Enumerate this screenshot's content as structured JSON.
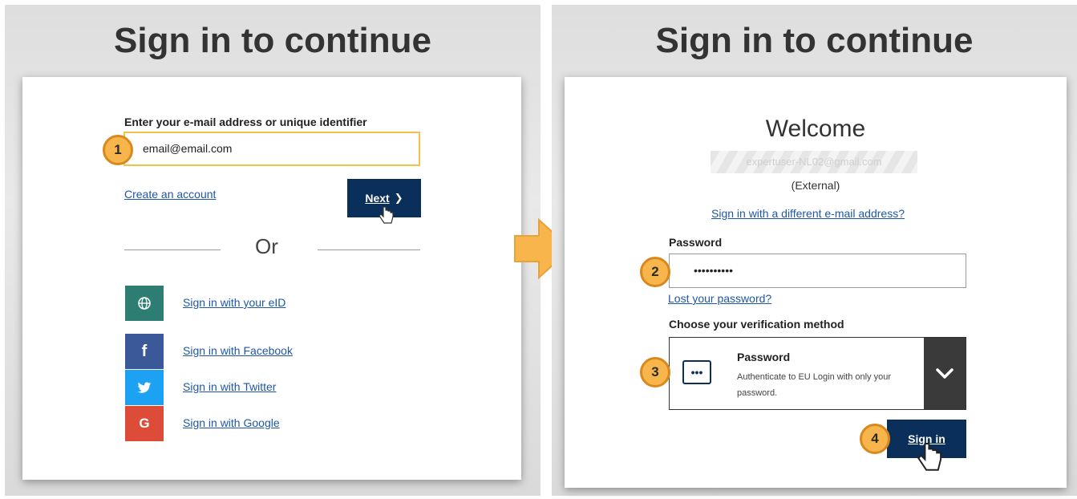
{
  "left": {
    "title": "Sign in to continue",
    "email_label": "Enter your e-mail address or unique identifier",
    "email_value": "email@email.com",
    "create_account": "Create an account",
    "next_label": "Next",
    "next_chevron": "❯",
    "or": "Or",
    "social": [
      {
        "icon": "globe-icon",
        "glyph": "⊕",
        "color": "#2e7d73",
        "label": "Sign in with your eID"
      },
      {
        "icon": "facebook-icon",
        "glyph": "f",
        "color": "#3b5998",
        "label": "Sign in with Facebook"
      },
      {
        "icon": "twitter-icon",
        "glyph": "🐦",
        "color": "#1da1f2",
        "label": "Sign in with Twitter"
      },
      {
        "icon": "google-icon",
        "glyph": "G",
        "color": "#dd4b39",
        "label": "Sign in with Google"
      }
    ],
    "step1": "1"
  },
  "right": {
    "title": "Sign in to continue",
    "welcome": "Welcome",
    "email_blurred": "expertuser-NL02@gmail.com",
    "external": "(External)",
    "different_email": "Sign in with a different e-mail address?",
    "password_label": "Password",
    "password_value": "••••••••••",
    "lost_password": "Lost your password?",
    "verification_label": "Choose your verification method",
    "method_title": "Password",
    "method_desc": "Authenticate to EU Login with only your password.",
    "method_icon_glyph": "•••",
    "signin_label": "Sign in",
    "step2": "2",
    "step3": "3",
    "step4": "4"
  },
  "colors": {
    "primary": "#0b2f5b",
    "badge": "#f7b54c",
    "arrow": "#f7b54c",
    "link": "#1f57a8"
  }
}
